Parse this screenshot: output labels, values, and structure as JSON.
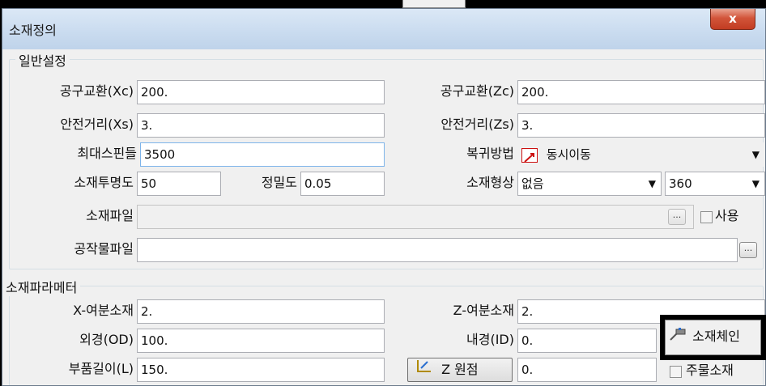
{
  "window": {
    "title": "소재정의",
    "close_label": "x"
  },
  "general": {
    "group_title": "일반설정",
    "tool_change_xc": {
      "label": "공구교환(Xc)",
      "value": "200."
    },
    "tool_change_zc": {
      "label": "공구교환(Zc)",
      "value": "200."
    },
    "safe_dist_xs": {
      "label": "안전거리(Xs)",
      "value": "3."
    },
    "safe_dist_zs": {
      "label": "안전거리(Zs)",
      "value": "3."
    },
    "max_spindle": {
      "label": "최대스핀들",
      "value": "3500"
    },
    "return_method": {
      "label": "복귀방법",
      "value": "동시이동"
    },
    "transparency": {
      "label": "소재투명도",
      "value": "50"
    },
    "precision": {
      "label": "정밀도",
      "value": "0.05"
    },
    "shape": {
      "label": "소재형상",
      "value": "없음",
      "angle": "360"
    },
    "stock_file": {
      "label": "소재파일",
      "value": "",
      "browse": "...",
      "use_label": "사용"
    },
    "work_file": {
      "label": "공작물파일",
      "value": "",
      "browse": "..."
    }
  },
  "params": {
    "group_title": "소재파라메터",
    "x_allowance": {
      "label": "X-여분소재",
      "value": "2."
    },
    "z_allowance": {
      "label": "Z-여분소재",
      "value": "2."
    },
    "outer_dia": {
      "label": "외경(OD)",
      "value": "100."
    },
    "inner_dia": {
      "label": "내경(ID)",
      "value": "0."
    },
    "part_length": {
      "label": "부품길이(L)",
      "value": "150."
    },
    "z_origin": {
      "label": "Z 원점",
      "value": "0."
    },
    "chain_button": "소재체인",
    "casting_label": "주물소재"
  },
  "icons": {
    "close": "close-icon",
    "return": "return-method-icon",
    "chain": "chain-icon",
    "origin": "z-origin-icon"
  },
  "colors": {
    "close_red": "#c23c22",
    "icon_red": "#cc1111"
  }
}
